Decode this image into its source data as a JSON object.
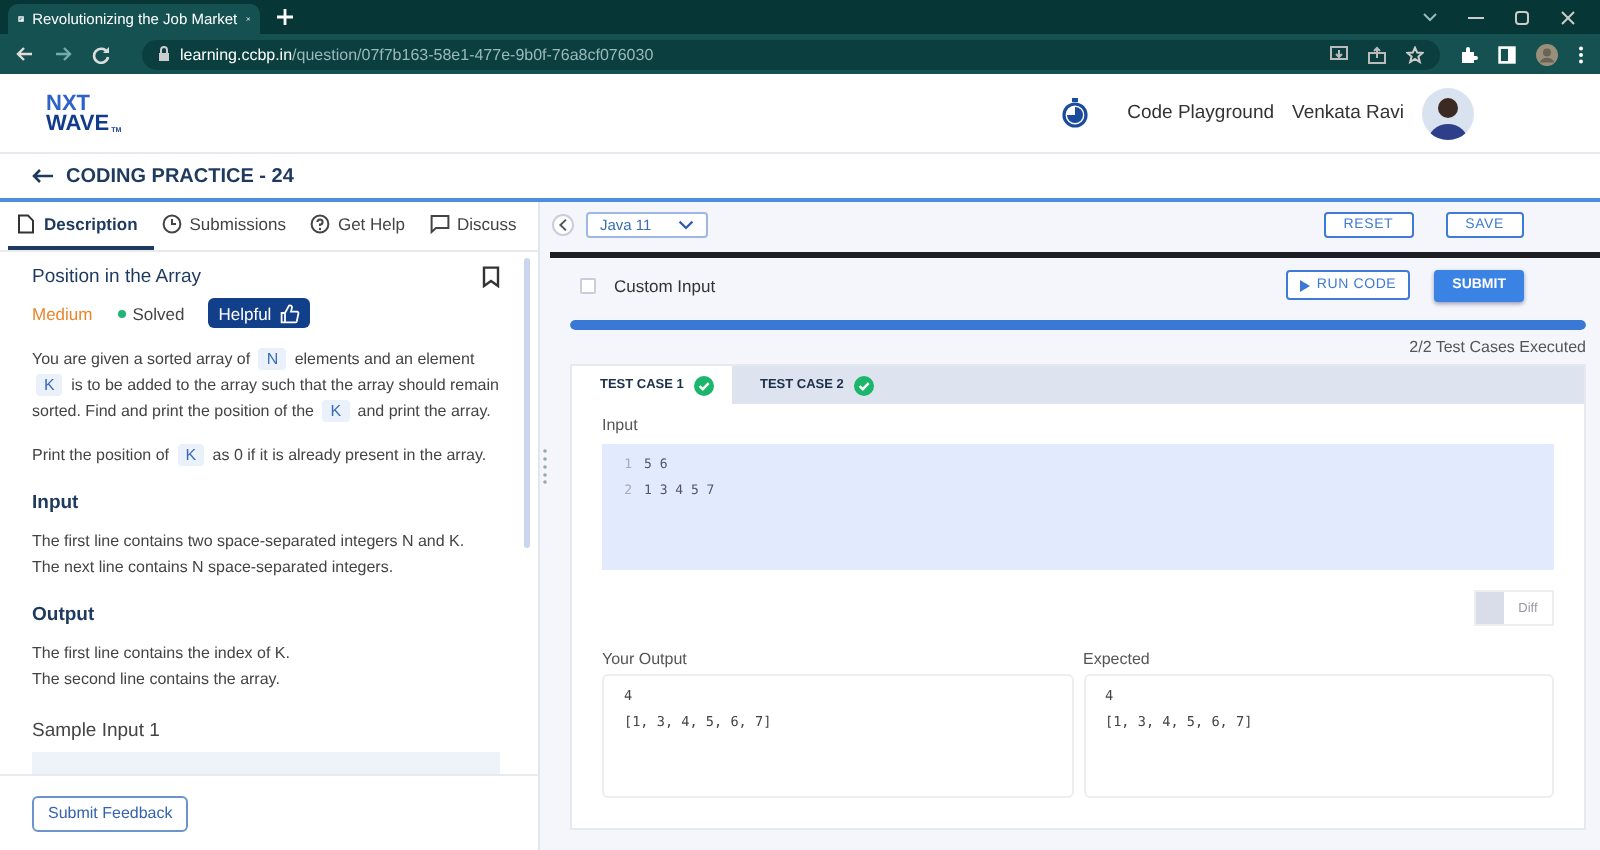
{
  "browser": {
    "tab_title": "Revolutionizing the Job Market",
    "url_host": "learning.ccbp.in",
    "url_path": "/question/07f7b163-58e1-477e-9b0f-76a8cf076030"
  },
  "header": {
    "logo_top": "NXT",
    "logo_bottom": "WAVE",
    "logo_mark": "TM",
    "links": [
      "Code Playground"
    ],
    "user_name": "Venkata Ravi"
  },
  "page_title": "CODING PRACTICE - 24",
  "left_tabs": [
    {
      "label": "Description",
      "selected": true
    },
    {
      "label": "Submissions",
      "selected": false
    },
    {
      "label": "Get Help",
      "selected": false
    },
    {
      "label": "Discuss",
      "selected": false
    }
  ],
  "problem": {
    "title": "Position in the Array",
    "difficulty": "Medium",
    "status": "Solved",
    "helpful_label": "Helpful",
    "paragraphs": [
      [
        {
          "kind": "text",
          "text": "You are given a sorted array of "
        },
        {
          "kind": "code",
          "text": "N"
        },
        {
          "kind": "text",
          "text": " elements and an element "
        },
        {
          "kind": "code",
          "text": "K"
        },
        {
          "kind": "text",
          "text": " is to be added to the array such that the array should remain sorted. Find and print the position of the "
        },
        {
          "kind": "code",
          "text": "K"
        },
        {
          "kind": "text",
          "text": " and print the array."
        }
      ],
      [
        {
          "kind": "text",
          "text": "Print the position of "
        },
        {
          "kind": "code",
          "text": "K"
        },
        {
          "kind": "text",
          "text": " as 0 if it is already present in the array."
        }
      ]
    ],
    "sections": [
      {
        "heading": "Input",
        "lines": [
          "The first line contains two space-separated integers N and K.",
          "The next line contains N space-separated integers."
        ]
      },
      {
        "heading": "Output",
        "lines": [
          "The first line contains the index of K.",
          "The second line contains the array."
        ]
      }
    ],
    "sample_heading": "Sample Input 1"
  },
  "feedback_button": "Submit Feedback",
  "editor": {
    "language": "Java 11",
    "buttons": [
      "RESET",
      "SAVE"
    ],
    "custom_input": {
      "label": "Custom Input",
      "checked": false
    },
    "run_label": "RUN CODE",
    "submit_label": "SUBMIT"
  },
  "progress": {
    "level": 1,
    "text": "2/2 Test Cases Executed"
  },
  "test_cases": [
    {
      "label": "TEST CASE 1",
      "passed": true,
      "selected": true
    },
    {
      "label": "TEST CASE 2",
      "passed": true,
      "selected": false
    }
  ],
  "input": {
    "label": "Input",
    "lines": [
      {
        "number": "1",
        "text": "5 6"
      },
      {
        "number": "2",
        "text": "1 3 4 5 7"
      }
    ]
  },
  "diff": {
    "label": "Diff",
    "on": false
  },
  "outputs": [
    {
      "label": "Your Output",
      "lines": [
        "4",
        "[1, 3, 4, 5, 6, 7]"
      ]
    },
    {
      "label": "Expected",
      "lines": [
        "4",
        "[1, 3, 4, 5, 6, 7]"
      ]
    }
  ]
}
